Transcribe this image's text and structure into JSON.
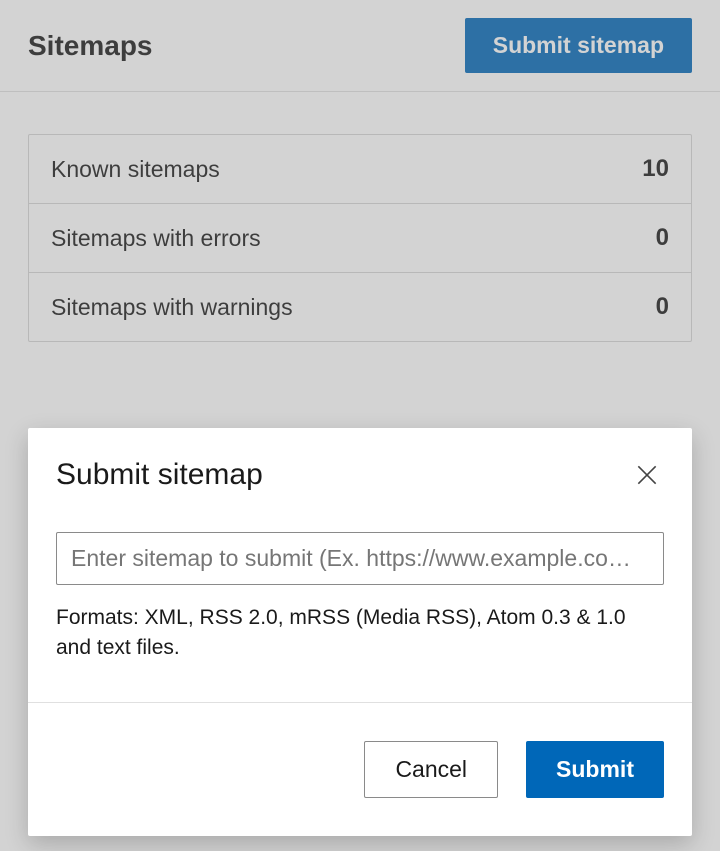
{
  "header": {
    "title": "Sitemaps",
    "submit_button": "Submit sitemap"
  },
  "stats": [
    {
      "label": "Known sitemaps",
      "value": "10"
    },
    {
      "label": "Sitemaps with errors",
      "value": "0"
    },
    {
      "label": "Sitemaps with warnings",
      "value": "0"
    }
  ],
  "modal": {
    "title": "Submit sitemap",
    "input_placeholder": "Enter sitemap to submit (Ex. https://www.example.com/sitemap.xml)",
    "input_value": "",
    "formats_text": "Formats: XML, RSS 2.0, mRSS (Media RSS), Atom 0.3 & 1.0 and text files.",
    "cancel_label": "Cancel",
    "submit_label": "Submit"
  }
}
